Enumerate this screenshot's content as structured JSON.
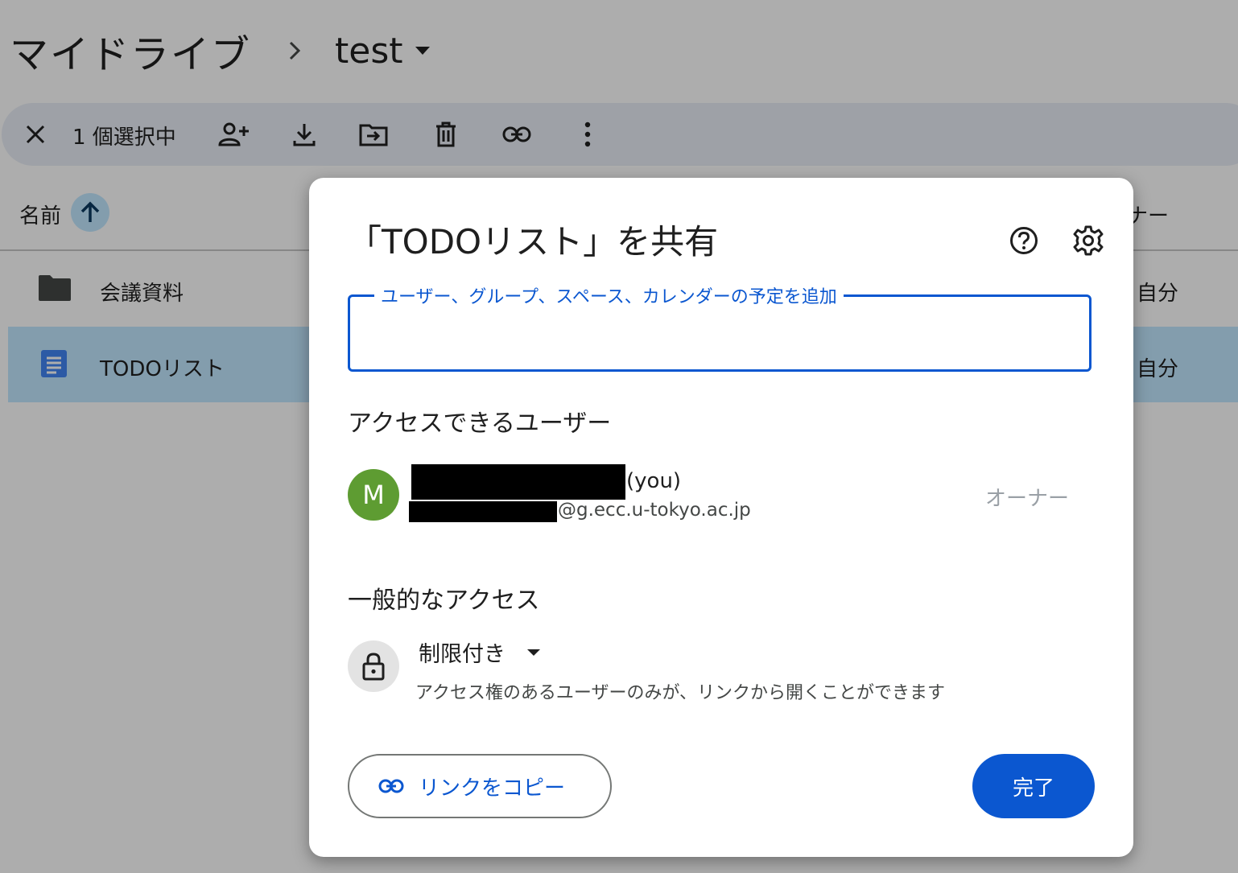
{
  "breadcrumb": {
    "root": "マイドライブ",
    "current": "test"
  },
  "selection_bar": {
    "count_label": "1 個選択中"
  },
  "file_list": {
    "col_name": "名前",
    "col_owner": "ナー",
    "rows": [
      {
        "name": "会議資料",
        "owner": "自分",
        "type": "folder"
      },
      {
        "name": "TODOリスト",
        "owner": "自分",
        "type": "document"
      }
    ]
  },
  "dialog": {
    "title": "「TODOリスト」を共有",
    "add_field_label": "ユーザー、グループ、スペース、カレンダーの予定を追加",
    "add_field_value": "",
    "access_section_title": "アクセスできるユーザー",
    "user": {
      "avatar_letter": "M",
      "you_suffix": "(you)",
      "email_domain": "@g.ecc.u-tokyo.ac.jp",
      "role": "オーナー"
    },
    "general_section_title": "一般的なアクセス",
    "general_access": {
      "selected": "制限付き",
      "description": "アクセス権のあるユーザーのみが、リンクから開くことができます"
    },
    "copy_link_label": "リンクをコピー",
    "done_label": "完了"
  },
  "colors": {
    "accent": "#0b57d0",
    "avatar": "#5e9c32",
    "selected_row": "#c2e7ff",
    "doc_icon": "#4285f4"
  },
  "icons": [
    "chevron-right-icon",
    "dropdown-arrow-icon",
    "close-icon",
    "share-person-add-icon",
    "download-icon",
    "move-to-folder-icon",
    "trash-icon",
    "link-icon",
    "more-vert-icon",
    "arrow-up-icon",
    "folder-icon",
    "docs-icon",
    "help-icon",
    "gear-icon",
    "lock-icon"
  ]
}
